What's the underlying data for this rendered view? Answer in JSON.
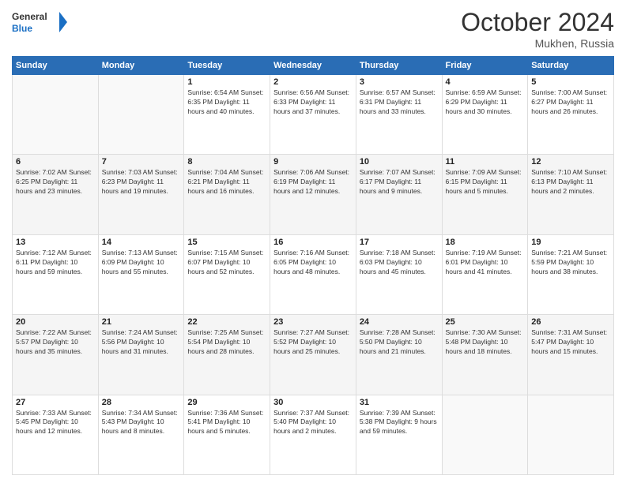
{
  "header": {
    "logo_line1": "General",
    "logo_line2": "Blue",
    "month": "October 2024",
    "location": "Mukhen, Russia"
  },
  "weekdays": [
    "Sunday",
    "Monday",
    "Tuesday",
    "Wednesday",
    "Thursday",
    "Friday",
    "Saturday"
  ],
  "weeks": [
    [
      {
        "day": "",
        "info": ""
      },
      {
        "day": "",
        "info": ""
      },
      {
        "day": "1",
        "info": "Sunrise: 6:54 AM\nSunset: 6:35 PM\nDaylight: 11 hours and 40 minutes."
      },
      {
        "day": "2",
        "info": "Sunrise: 6:56 AM\nSunset: 6:33 PM\nDaylight: 11 hours and 37 minutes."
      },
      {
        "day": "3",
        "info": "Sunrise: 6:57 AM\nSunset: 6:31 PM\nDaylight: 11 hours and 33 minutes."
      },
      {
        "day": "4",
        "info": "Sunrise: 6:59 AM\nSunset: 6:29 PM\nDaylight: 11 hours and 30 minutes."
      },
      {
        "day": "5",
        "info": "Sunrise: 7:00 AM\nSunset: 6:27 PM\nDaylight: 11 hours and 26 minutes."
      }
    ],
    [
      {
        "day": "6",
        "info": "Sunrise: 7:02 AM\nSunset: 6:25 PM\nDaylight: 11 hours and 23 minutes."
      },
      {
        "day": "7",
        "info": "Sunrise: 7:03 AM\nSunset: 6:23 PM\nDaylight: 11 hours and 19 minutes."
      },
      {
        "day": "8",
        "info": "Sunrise: 7:04 AM\nSunset: 6:21 PM\nDaylight: 11 hours and 16 minutes."
      },
      {
        "day": "9",
        "info": "Sunrise: 7:06 AM\nSunset: 6:19 PM\nDaylight: 11 hours and 12 minutes."
      },
      {
        "day": "10",
        "info": "Sunrise: 7:07 AM\nSunset: 6:17 PM\nDaylight: 11 hours and 9 minutes."
      },
      {
        "day": "11",
        "info": "Sunrise: 7:09 AM\nSunset: 6:15 PM\nDaylight: 11 hours and 5 minutes."
      },
      {
        "day": "12",
        "info": "Sunrise: 7:10 AM\nSunset: 6:13 PM\nDaylight: 11 hours and 2 minutes."
      }
    ],
    [
      {
        "day": "13",
        "info": "Sunrise: 7:12 AM\nSunset: 6:11 PM\nDaylight: 10 hours and 59 minutes."
      },
      {
        "day": "14",
        "info": "Sunrise: 7:13 AM\nSunset: 6:09 PM\nDaylight: 10 hours and 55 minutes."
      },
      {
        "day": "15",
        "info": "Sunrise: 7:15 AM\nSunset: 6:07 PM\nDaylight: 10 hours and 52 minutes."
      },
      {
        "day": "16",
        "info": "Sunrise: 7:16 AM\nSunset: 6:05 PM\nDaylight: 10 hours and 48 minutes."
      },
      {
        "day": "17",
        "info": "Sunrise: 7:18 AM\nSunset: 6:03 PM\nDaylight: 10 hours and 45 minutes."
      },
      {
        "day": "18",
        "info": "Sunrise: 7:19 AM\nSunset: 6:01 PM\nDaylight: 10 hours and 41 minutes."
      },
      {
        "day": "19",
        "info": "Sunrise: 7:21 AM\nSunset: 5:59 PM\nDaylight: 10 hours and 38 minutes."
      }
    ],
    [
      {
        "day": "20",
        "info": "Sunrise: 7:22 AM\nSunset: 5:57 PM\nDaylight: 10 hours and 35 minutes."
      },
      {
        "day": "21",
        "info": "Sunrise: 7:24 AM\nSunset: 5:56 PM\nDaylight: 10 hours and 31 minutes."
      },
      {
        "day": "22",
        "info": "Sunrise: 7:25 AM\nSunset: 5:54 PM\nDaylight: 10 hours and 28 minutes."
      },
      {
        "day": "23",
        "info": "Sunrise: 7:27 AM\nSunset: 5:52 PM\nDaylight: 10 hours and 25 minutes."
      },
      {
        "day": "24",
        "info": "Sunrise: 7:28 AM\nSunset: 5:50 PM\nDaylight: 10 hours and 21 minutes."
      },
      {
        "day": "25",
        "info": "Sunrise: 7:30 AM\nSunset: 5:48 PM\nDaylight: 10 hours and 18 minutes."
      },
      {
        "day": "26",
        "info": "Sunrise: 7:31 AM\nSunset: 5:47 PM\nDaylight: 10 hours and 15 minutes."
      }
    ],
    [
      {
        "day": "27",
        "info": "Sunrise: 7:33 AM\nSunset: 5:45 PM\nDaylight: 10 hours and 12 minutes."
      },
      {
        "day": "28",
        "info": "Sunrise: 7:34 AM\nSunset: 5:43 PM\nDaylight: 10 hours and 8 minutes."
      },
      {
        "day": "29",
        "info": "Sunrise: 7:36 AM\nSunset: 5:41 PM\nDaylight: 10 hours and 5 minutes."
      },
      {
        "day": "30",
        "info": "Sunrise: 7:37 AM\nSunset: 5:40 PM\nDaylight: 10 hours and 2 minutes."
      },
      {
        "day": "31",
        "info": "Sunrise: 7:39 AM\nSunset: 5:38 PM\nDaylight: 9 hours and 59 minutes."
      },
      {
        "day": "",
        "info": ""
      },
      {
        "day": "",
        "info": ""
      }
    ]
  ]
}
